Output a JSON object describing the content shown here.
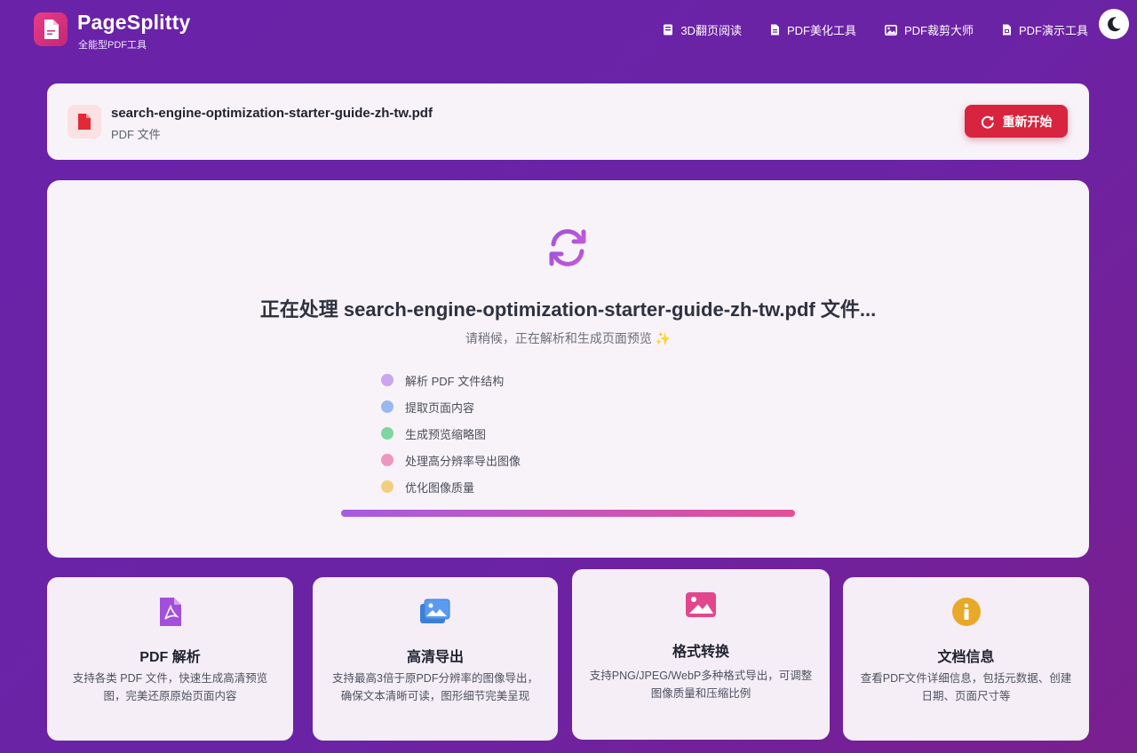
{
  "header": {
    "brand": "PageSplitty",
    "subtitle": "全能型PDF工具",
    "nav": [
      {
        "label": "3D翻页阅读",
        "icon": "book-icon"
      },
      {
        "label": "PDF美化工具",
        "icon": "document-icon"
      },
      {
        "label": "PDF裁剪大师",
        "icon": "image-icon"
      },
      {
        "label": "PDF演示工具",
        "icon": "presentation-file-icon"
      }
    ],
    "theme_toggle_icon": "moon-icon"
  },
  "file": {
    "name": "search-engine-optimization-starter-guide-zh-tw.pdf",
    "type": "PDF 文件",
    "restart_label": "重新开始"
  },
  "processing": {
    "title": "正在处理 search-engine-optimization-starter-guide-zh-tw.pdf 文件...",
    "subtitle": "请稍候，正在解析和生成页面预览 ✨",
    "steps": [
      {
        "label": "解析 PDF 文件结构",
        "color": "#c9a6ee"
      },
      {
        "label": "提取页面内容",
        "color": "#9ab8f0"
      },
      {
        "label": "生成预览缩略图",
        "color": "#7fd6a0"
      },
      {
        "label": "处理高分辨率导出图像",
        "color": "#ee96c0"
      },
      {
        "label": "优化图像质量",
        "color": "#f2cf7e"
      }
    ],
    "progress": 1.0
  },
  "features": [
    {
      "title": "PDF 解析",
      "desc": "支持各类 PDF 文件，快速生成高清预览图，完美还原原始页面内容",
      "icon": "pdf-file-icon"
    },
    {
      "title": "高清导出",
      "desc": "支持最高3倍于原PDF分辨率的图像导出，确保文本清晰可读，图形细节完美呈现",
      "icon": "images-icon"
    },
    {
      "title": "格式转换",
      "desc": "支持PNG/JPEG/WebP多种格式导出，可调整图像质量和压缩比例",
      "icon": "picture-icon"
    },
    {
      "title": "文档信息",
      "desc": "查看PDF文件详细信息，包括元数据、创建日期、页面尺寸等",
      "icon": "info-icon"
    }
  ]
}
